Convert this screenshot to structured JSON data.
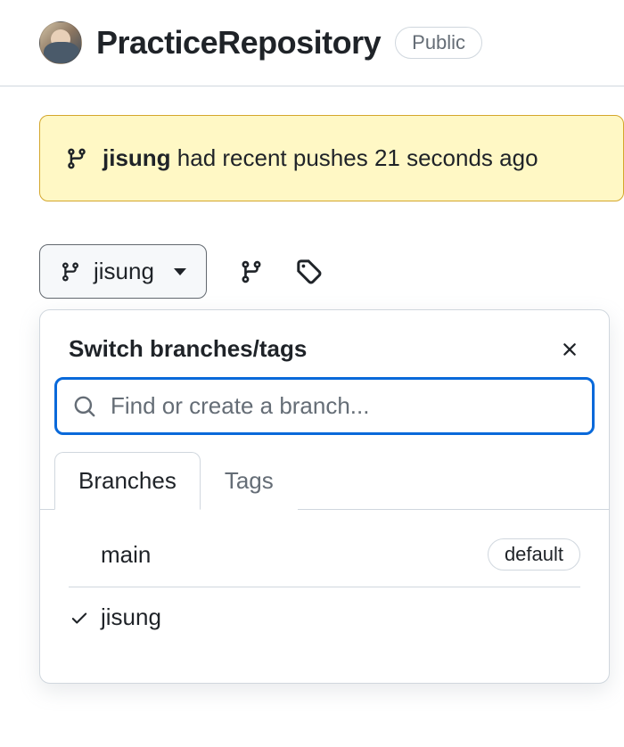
{
  "header": {
    "repo_name": "PracticeRepository",
    "visibility": "Public"
  },
  "alert": {
    "branch": "jisung",
    "suffix_text": " had recent pushes 21 seconds ago"
  },
  "branch_selector": {
    "current": "jisung"
  },
  "popover": {
    "title": "Switch branches/tags",
    "search_placeholder": "Find or create a branch...",
    "tabs": {
      "branches": "Branches",
      "tags": "Tags"
    },
    "branches": [
      {
        "name": "main",
        "default_label": "default",
        "selected": false
      },
      {
        "name": "jisung",
        "default_label": "",
        "selected": true
      }
    ]
  }
}
